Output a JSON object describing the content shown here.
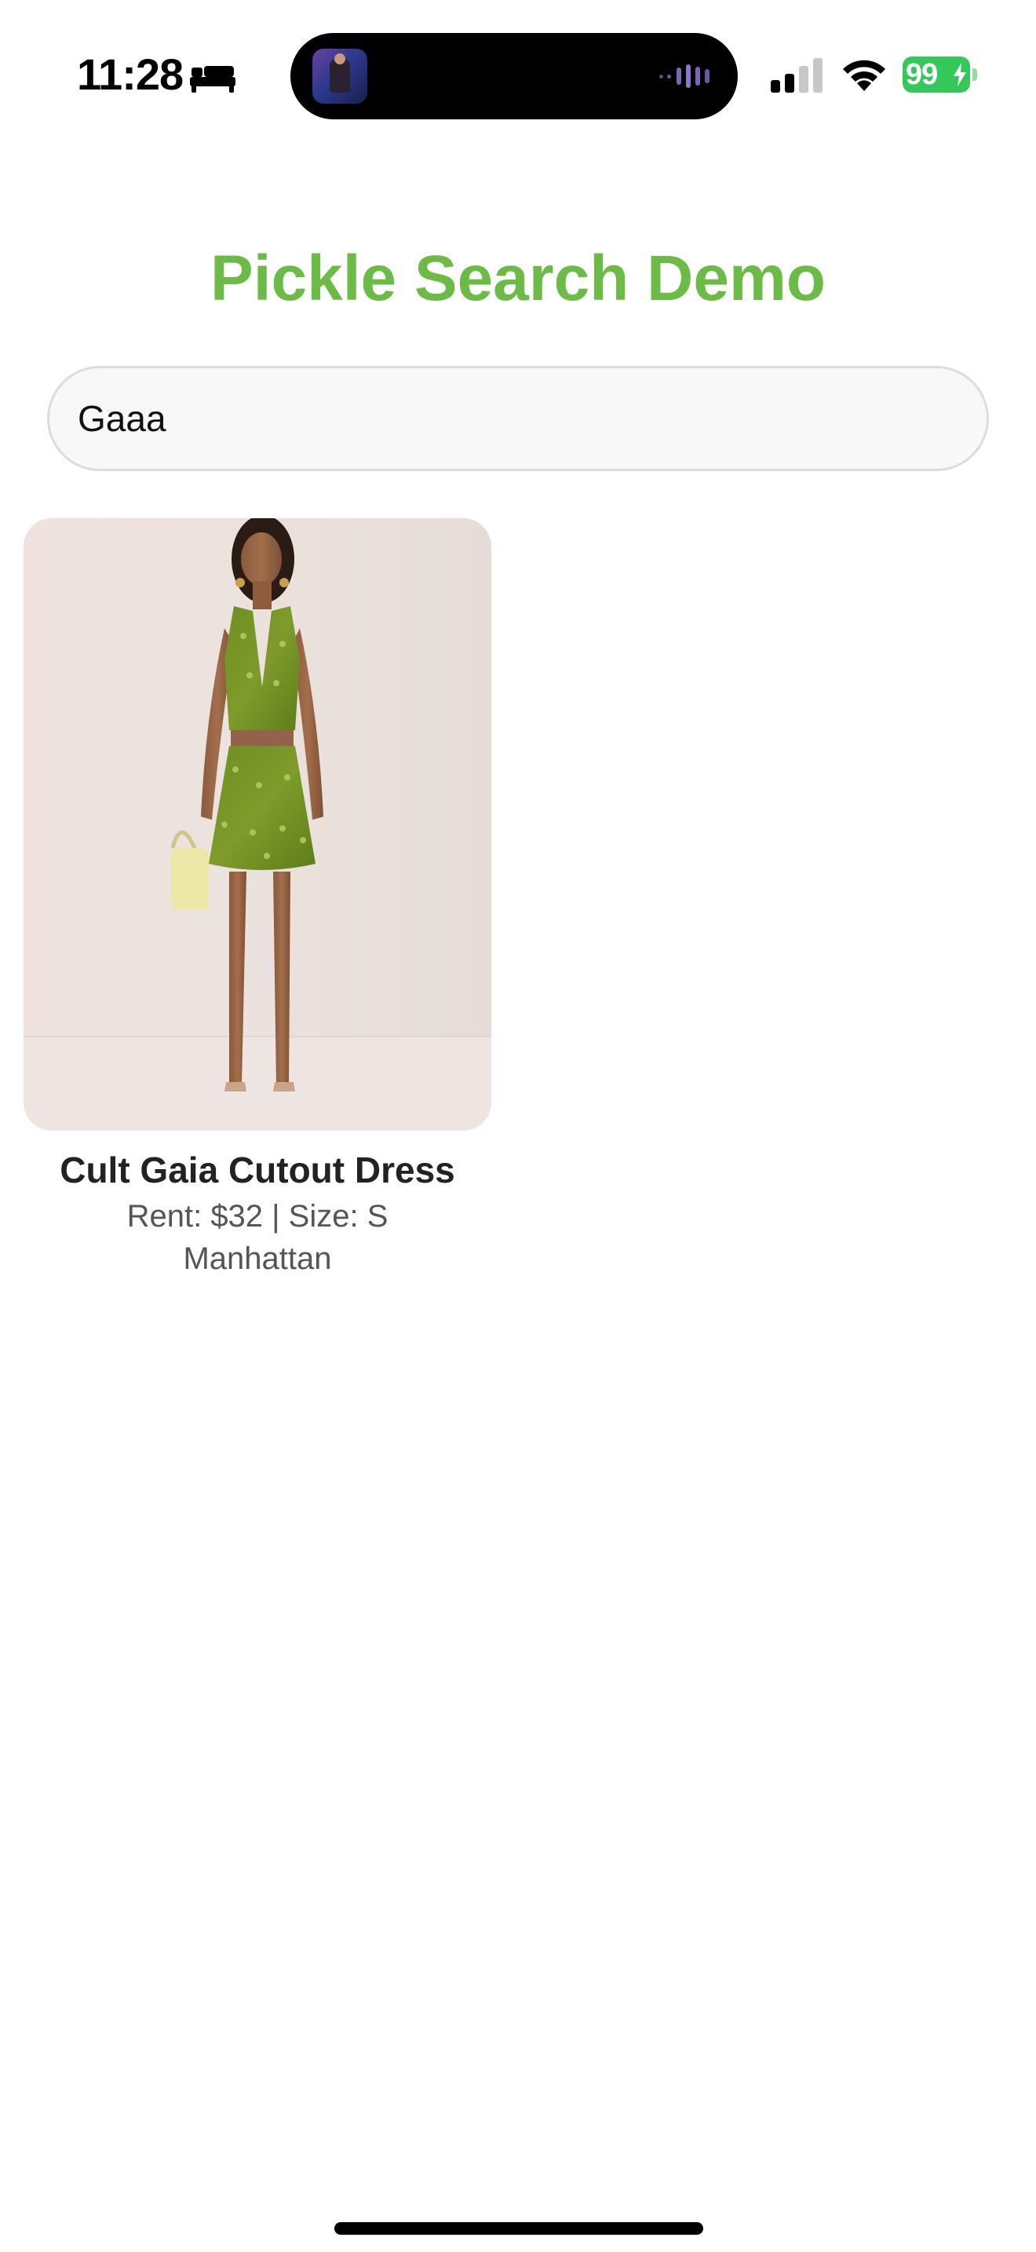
{
  "status_bar": {
    "time": "11:28",
    "battery_level": "99",
    "focus_icon": "bed-icon",
    "signal_icon": "cellular-signal-icon",
    "wifi_icon": "wifi-icon",
    "battery_color": "#34c759"
  },
  "header": {
    "title": "Pickle Search Demo",
    "title_color": "#6cbb46"
  },
  "search": {
    "value": "Gaaa",
    "icon": "none"
  },
  "results": [
    {
      "title": "Cult Gaia Cutout Dress",
      "meta": "Rent: $32 | Size: S",
      "location": "Manhattan",
      "image_description_icon": "product-photo"
    }
  ]
}
